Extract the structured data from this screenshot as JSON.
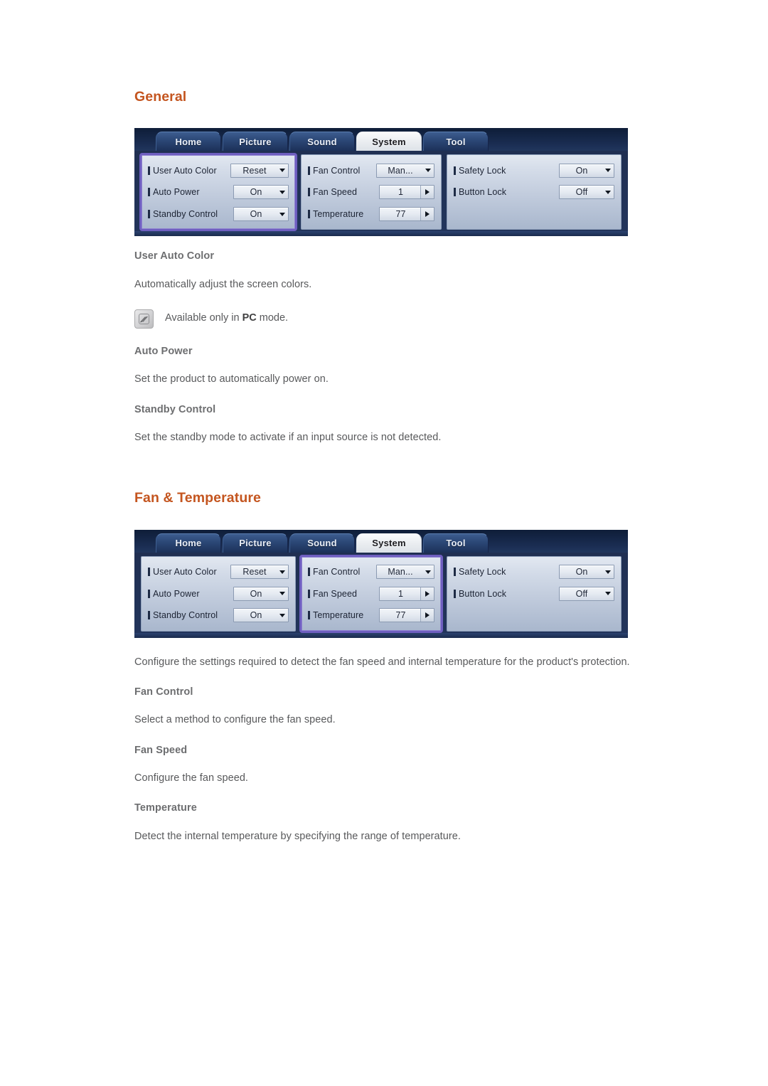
{
  "sections": [
    {
      "heading": "General",
      "osd": {
        "tabs": [
          {
            "label": "Home",
            "active": false
          },
          {
            "label": "Picture",
            "active": false
          },
          {
            "label": "Sound",
            "active": false
          },
          {
            "label": "System",
            "active": true
          },
          {
            "label": "Tool",
            "active": false
          }
        ],
        "highlight_column": 0,
        "columns": [
          {
            "rows": [
              {
                "label": "User Auto Color",
                "value": "Reset",
                "type": "select"
              },
              {
                "label": "Auto Power",
                "value": "On",
                "type": "select"
              },
              {
                "label": "Standby Control",
                "value": "On",
                "type": "select"
              }
            ]
          },
          {
            "rows": [
              {
                "label": "Fan Control",
                "value": "Man...",
                "type": "select"
              },
              {
                "label": "Fan Speed",
                "value": "1",
                "type": "spin"
              },
              {
                "label": "Temperature",
                "value": "77",
                "type": "spin"
              }
            ]
          },
          {
            "rows": [
              {
                "label": "Safety Lock",
                "value": "On",
                "type": "select"
              },
              {
                "label": "Button Lock",
                "value": "Off",
                "type": "select"
              }
            ]
          }
        ]
      },
      "blocks": [
        {
          "kind": "sub",
          "text": "User Auto Color"
        },
        {
          "kind": "body",
          "text": "Automatically adjust the screen colors."
        },
        {
          "kind": "note",
          "text_before": "Available only in ",
          "text_bold": "PC",
          "text_after": " mode.",
          "icon": "note-pencil-icon"
        },
        {
          "kind": "sub",
          "text": "Auto Power"
        },
        {
          "kind": "body",
          "text": "Set the product to automatically power on."
        },
        {
          "kind": "sub",
          "text": "Standby Control"
        },
        {
          "kind": "body",
          "text": "Set the standby mode to activate if an input source is not detected."
        }
      ]
    },
    {
      "heading": "Fan & Temperature",
      "osd": {
        "tabs": [
          {
            "label": "Home",
            "active": false
          },
          {
            "label": "Picture",
            "active": false
          },
          {
            "label": "Sound",
            "active": false
          },
          {
            "label": "System",
            "active": true
          },
          {
            "label": "Tool",
            "active": false
          }
        ],
        "highlight_column": 1,
        "columns": [
          {
            "rows": [
              {
                "label": "User Auto Color",
                "value": "Reset",
                "type": "select"
              },
              {
                "label": "Auto Power",
                "value": "On",
                "type": "select"
              },
              {
                "label": "Standby Control",
                "value": "On",
                "type": "select"
              }
            ]
          },
          {
            "rows": [
              {
                "label": "Fan Control",
                "value": "Man...",
                "type": "select"
              },
              {
                "label": "Fan Speed",
                "value": "1",
                "type": "spin"
              },
              {
                "label": "Temperature",
                "value": "77",
                "type": "spin"
              }
            ]
          },
          {
            "rows": [
              {
                "label": "Safety Lock",
                "value": "On",
                "type": "select"
              },
              {
                "label": "Button Lock",
                "value": "Off",
                "type": "select"
              }
            ]
          }
        ]
      },
      "blocks": [
        {
          "kind": "body",
          "text": "Configure the settings required to detect the fan speed and internal temperature for the product's protection."
        },
        {
          "kind": "sub",
          "text": "Fan Control"
        },
        {
          "kind": "body",
          "text": "Select a method to configure the fan speed."
        },
        {
          "kind": "sub",
          "text": "Fan Speed"
        },
        {
          "kind": "body",
          "text": "Configure the fan speed."
        },
        {
          "kind": "sub",
          "text": "Temperature"
        },
        {
          "kind": "body",
          "text": "Detect the internal temperature by specifying the range of temperature."
        }
      ]
    }
  ],
  "colors": {
    "heading_orange": "#c4551f",
    "body_gray": "#58595b",
    "subheading_gray": "#6d6e70",
    "osd_dark_blue": "#1d3355",
    "highlight_purple": "#6f5fc0"
  }
}
